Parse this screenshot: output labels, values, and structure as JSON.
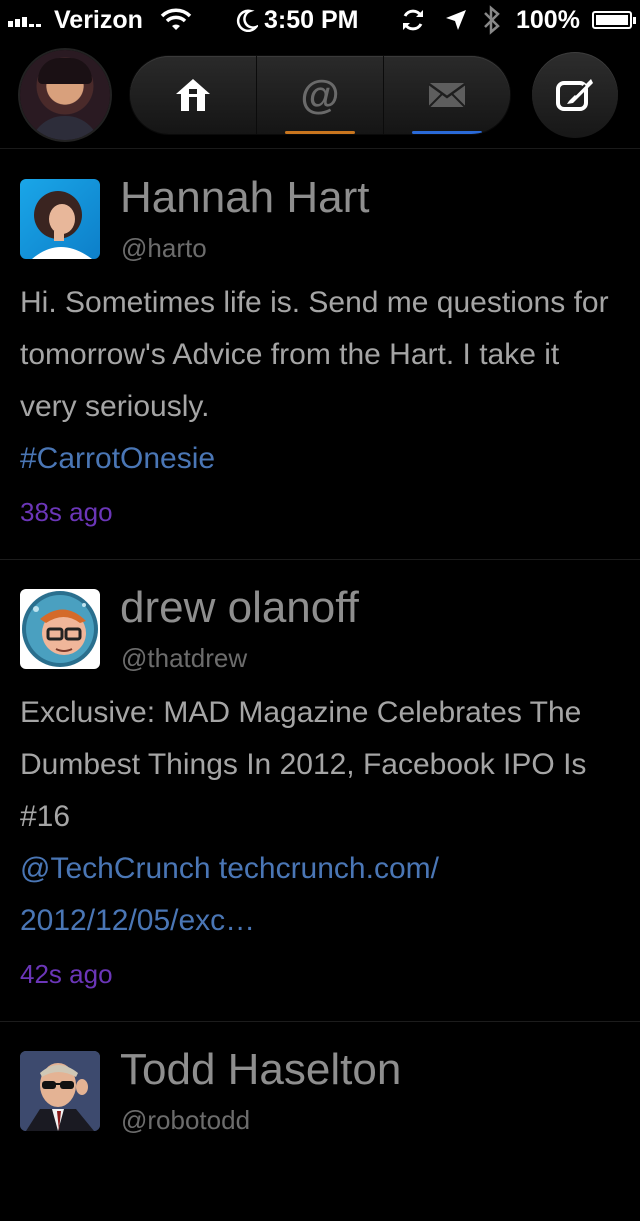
{
  "status_bar": {
    "carrier": "Verizon",
    "time": "3:50 PM",
    "battery": "100%"
  },
  "nav": {
    "tabs": [
      {
        "name": "home",
        "icon": "home-icon",
        "indicator_color": ""
      },
      {
        "name": "mentions",
        "icon": "at-icon",
        "glyph": "@",
        "indicator_color": "#c8751e"
      },
      {
        "name": "messages",
        "icon": "mail-icon",
        "indicator_color": "#2a6ad8"
      }
    ]
  },
  "colors": {
    "link": "#4a76b5",
    "timestamp": "#6b36b8",
    "name": "#8e8e8e",
    "body": "#a5a5a5"
  },
  "tweets": [
    {
      "name": "Hannah Hart",
      "handle": "@harto",
      "text": "Hi. Sometimes life is. Send me questions for tomorrow's Advice from the Hart. I take it very seriously.",
      "link": "#CarrotOnesie",
      "time": "38s ago"
    },
    {
      "name": "drew olanoff",
      "handle": "@thatdrew",
      "text": "Exclusive: MAD Magazine Celebrates The Dumbest Things In 2012, Facebook IPO Is #16",
      "link": "@TechCrunch techcrunch.com/ 2012/12/05/exc…",
      "time": "42s ago"
    },
    {
      "name": "Todd Haselton",
      "handle": "@robotodd",
      "text": "",
      "link": "",
      "time": ""
    }
  ]
}
